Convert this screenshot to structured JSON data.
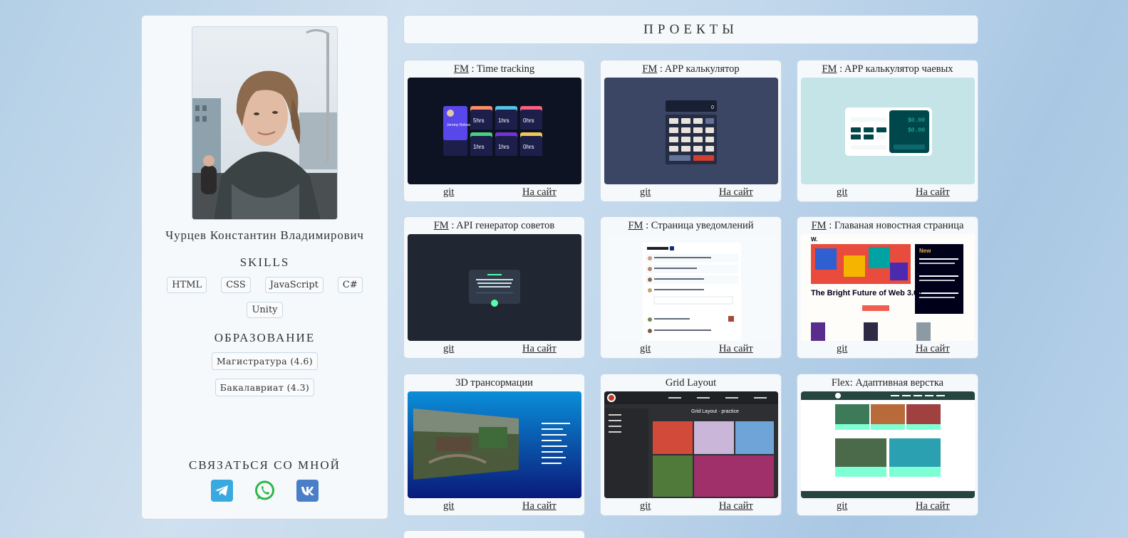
{
  "profile": {
    "name": "Чурцев Константин Владимирович",
    "skills_title": "SKILLS",
    "skills": [
      "HTML",
      "CSS",
      "JavaScript",
      "C#",
      "Unity"
    ],
    "education_title": "ОБРАЗОВАНИЕ",
    "education": [
      "Магистратура (4.6)",
      "Бакалавриат (4.3)"
    ],
    "contact_title": "СВЯЗАТЬСЯ СО МНОЙ",
    "socials": [
      {
        "icon": "telegram-icon",
        "color": "#3aa9e0"
      },
      {
        "icon": "whatsapp-icon",
        "color": "#2fb64a"
      },
      {
        "icon": "vk-icon",
        "color": "#4a7fc8"
      }
    ]
  },
  "projects": {
    "header": "ПРОЕКТЫ",
    "git_label": "git",
    "site_label": "На сайт",
    "cards": [
      {
        "prefix": "FM",
        "title": ": Time tracking"
      },
      {
        "prefix": "FM",
        "title": ": APP калькулятор"
      },
      {
        "prefix": "FM",
        "title": ": APP калькулятор чаевых"
      },
      {
        "prefix": "FM",
        "title": ": API генератор советов"
      },
      {
        "prefix": "FM",
        "title": ": Страница уведомлений"
      },
      {
        "prefix": "FM",
        "title": ": Главаная новостная страница"
      },
      {
        "prefix": "",
        "title": "3D трансормации"
      },
      {
        "prefix": "",
        "title": "Grid Layout"
      },
      {
        "prefix": "",
        "title": "Flex: Адаптивная верстка"
      }
    ]
  },
  "thumbnails": {
    "time_tracking": {
      "user": "Jeremy Robson",
      "hours": [
        "5hrs",
        "1hrs",
        "0hrs",
        "1hrs",
        "1hrs",
        "0hrs"
      ]
    },
    "news": {
      "headline": "The Bright Future of Web 3.0?",
      "side_title": "New"
    },
    "grid": {
      "title": "Grid Layout · practice"
    },
    "calc": {
      "display": "0"
    },
    "tip": {
      "amounts": [
        "$0.00",
        "$0.00"
      ]
    }
  },
  "colors": {
    "accent": "#c9d8e6",
    "card_bg": "#f6f9fc",
    "time_bg": "#0e1323",
    "calc_bg": "#3a4663",
    "tip_bg": "#c5e4e7",
    "advice_bg": "#202632",
    "grid_bg": "#2d2f33"
  }
}
